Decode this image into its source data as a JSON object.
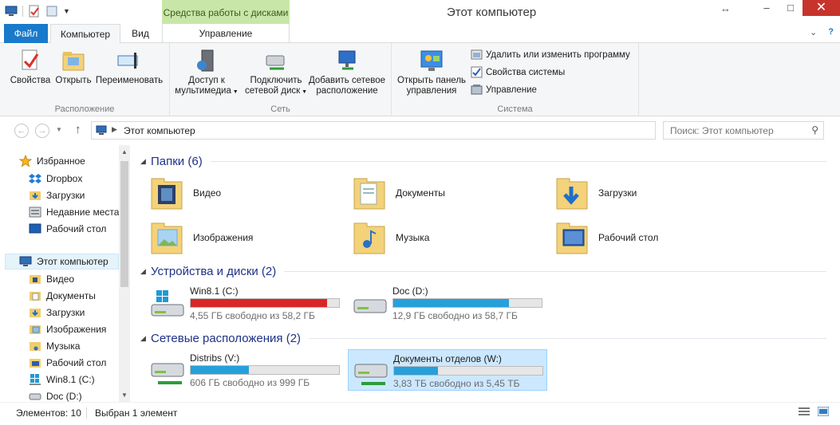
{
  "titlebar": {
    "window_title": "Этот компьютер",
    "context_tab": "Средства работы с дисками",
    "minimize": "–",
    "maximize": "□",
    "close": "✕",
    "resize_glyph": "↔"
  },
  "tabs": {
    "file": "Файл",
    "computer": "Компьютер",
    "view": "Вид",
    "manage": "Управление",
    "minimize_ribbon": "⌄",
    "help": "?"
  },
  "ribbon": {
    "location": {
      "label": "Расположение",
      "properties": "Свойства",
      "open": "Открыть",
      "rename": "Переименовать"
    },
    "network": {
      "label": "Сеть",
      "media_access": [
        "Доступ к",
        "мультимедиа"
      ],
      "map_drive": [
        "Подключить",
        "сетевой диск"
      ],
      "add_location": [
        "Добавить сетевое",
        "расположение"
      ]
    },
    "system": {
      "label": "Система",
      "control_panel": [
        "Открыть панель",
        "управления"
      ],
      "uninstall": "Удалить или изменить программу",
      "system_props": "Свойства системы",
      "manage": "Управление"
    }
  },
  "address": {
    "path": "Этот компьютер",
    "search_placeholder": "Поиск: Этот компьютер"
  },
  "nav": {
    "favorites": "Избранное",
    "fav_items": [
      "Dropbox",
      "Загрузки",
      "Недавние места",
      "Рабочий стол"
    ],
    "this_pc": "Этот компьютер",
    "pc_items": [
      "Видео",
      "Документы",
      "Загрузки",
      "Изображения",
      "Музыка",
      "Рабочий стол",
      "Win8.1 (C:)",
      "Doc (D:)"
    ]
  },
  "content": {
    "folders_title": "Папки (6)",
    "folders": [
      "Видео",
      "Документы",
      "Загрузки",
      "Изображения",
      "Музыка",
      "Рабочий стол"
    ],
    "devices_title": "Устройства и диски (2)",
    "drives": [
      {
        "name": "Win8.1 (C:)",
        "free": "4,55 ГБ свободно из 58,2 ГБ",
        "used_fraction": 0.922,
        "color": "#da2626"
      },
      {
        "name": "Doc (D:)",
        "free": "12,9 ГБ свободно из 58,7 ГБ",
        "used_fraction": 0.78,
        "color": "#26a0da"
      }
    ],
    "network_title": "Сетевые расположения (2)",
    "network_drives": [
      {
        "name": "Distribs (V:)",
        "free": "606 ГБ свободно из 999 ГБ",
        "used_fraction": 0.393,
        "color": "#26a0da"
      },
      {
        "name": "Документы отделов (W:)",
        "free": "3,83 ТБ свободно из 5,45 ТБ",
        "used_fraction": 0.297,
        "color": "#26a0da"
      }
    ]
  },
  "status": {
    "count": "Элементов: 10",
    "selected": "Выбран 1 элемент"
  },
  "colors": {
    "accent": "#1979ca",
    "context_tab": "#c9e6a9",
    "close_button": "#c7342c",
    "selection": "#cce8ff"
  }
}
